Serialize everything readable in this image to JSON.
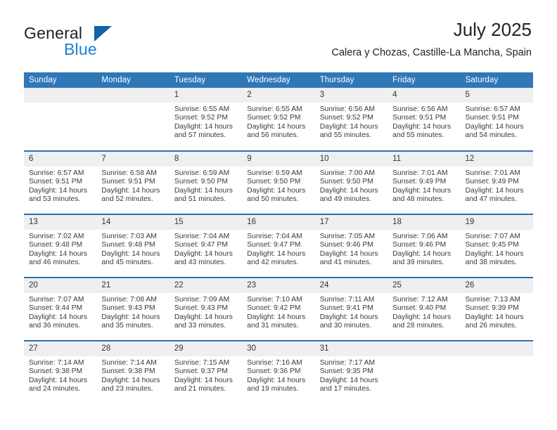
{
  "brand": {
    "word_general": "General",
    "word_blue": "Blue",
    "triangle_color": "#1162ab",
    "blue_color": "#1a7fd4"
  },
  "header": {
    "title": "July 2025",
    "subtitle": "Calera y Chozas, Castille-La Mancha, Spain"
  },
  "colors": {
    "header_blue": "#3077b8",
    "rule_blue": "#2f6fb0",
    "daynum_band": "#efeff0"
  },
  "weekday_headers": [
    "Sunday",
    "Monday",
    "Tuesday",
    "Wednesday",
    "Thursday",
    "Friday",
    "Saturday"
  ],
  "weeks": [
    [
      {
        "day": "",
        "sunrise": "",
        "sunset": "",
        "daylight1": "",
        "daylight2": ""
      },
      {
        "day": "",
        "sunrise": "",
        "sunset": "",
        "daylight1": "",
        "daylight2": ""
      },
      {
        "day": "1",
        "sunrise": "Sunrise: 6:55 AM",
        "sunset": "Sunset: 9:52 PM",
        "daylight1": "Daylight: 14 hours",
        "daylight2": "and 57 minutes."
      },
      {
        "day": "2",
        "sunrise": "Sunrise: 6:55 AM",
        "sunset": "Sunset: 9:52 PM",
        "daylight1": "Daylight: 14 hours",
        "daylight2": "and 56 minutes."
      },
      {
        "day": "3",
        "sunrise": "Sunrise: 6:56 AM",
        "sunset": "Sunset: 9:52 PM",
        "daylight1": "Daylight: 14 hours",
        "daylight2": "and 55 minutes."
      },
      {
        "day": "4",
        "sunrise": "Sunrise: 6:56 AM",
        "sunset": "Sunset: 9:51 PM",
        "daylight1": "Daylight: 14 hours",
        "daylight2": "and 55 minutes."
      },
      {
        "day": "5",
        "sunrise": "Sunrise: 6:57 AM",
        "sunset": "Sunset: 9:51 PM",
        "daylight1": "Daylight: 14 hours",
        "daylight2": "and 54 minutes."
      }
    ],
    [
      {
        "day": "6",
        "sunrise": "Sunrise: 6:57 AM",
        "sunset": "Sunset: 9:51 PM",
        "daylight1": "Daylight: 14 hours",
        "daylight2": "and 53 minutes."
      },
      {
        "day": "7",
        "sunrise": "Sunrise: 6:58 AM",
        "sunset": "Sunset: 9:51 PM",
        "daylight1": "Daylight: 14 hours",
        "daylight2": "and 52 minutes."
      },
      {
        "day": "8",
        "sunrise": "Sunrise: 6:59 AM",
        "sunset": "Sunset: 9:50 PM",
        "daylight1": "Daylight: 14 hours",
        "daylight2": "and 51 minutes."
      },
      {
        "day": "9",
        "sunrise": "Sunrise: 6:59 AM",
        "sunset": "Sunset: 9:50 PM",
        "daylight1": "Daylight: 14 hours",
        "daylight2": "and 50 minutes."
      },
      {
        "day": "10",
        "sunrise": "Sunrise: 7:00 AM",
        "sunset": "Sunset: 9:50 PM",
        "daylight1": "Daylight: 14 hours",
        "daylight2": "and 49 minutes."
      },
      {
        "day": "11",
        "sunrise": "Sunrise: 7:01 AM",
        "sunset": "Sunset: 9:49 PM",
        "daylight1": "Daylight: 14 hours",
        "daylight2": "and 48 minutes."
      },
      {
        "day": "12",
        "sunrise": "Sunrise: 7:01 AM",
        "sunset": "Sunset: 9:49 PM",
        "daylight1": "Daylight: 14 hours",
        "daylight2": "and 47 minutes."
      }
    ],
    [
      {
        "day": "13",
        "sunrise": "Sunrise: 7:02 AM",
        "sunset": "Sunset: 9:48 PM",
        "daylight1": "Daylight: 14 hours",
        "daylight2": "and 46 minutes."
      },
      {
        "day": "14",
        "sunrise": "Sunrise: 7:03 AM",
        "sunset": "Sunset: 9:48 PM",
        "daylight1": "Daylight: 14 hours",
        "daylight2": "and 45 minutes."
      },
      {
        "day": "15",
        "sunrise": "Sunrise: 7:04 AM",
        "sunset": "Sunset: 9:47 PM",
        "daylight1": "Daylight: 14 hours",
        "daylight2": "and 43 minutes."
      },
      {
        "day": "16",
        "sunrise": "Sunrise: 7:04 AM",
        "sunset": "Sunset: 9:47 PM",
        "daylight1": "Daylight: 14 hours",
        "daylight2": "and 42 minutes."
      },
      {
        "day": "17",
        "sunrise": "Sunrise: 7:05 AM",
        "sunset": "Sunset: 9:46 PM",
        "daylight1": "Daylight: 14 hours",
        "daylight2": "and 41 minutes."
      },
      {
        "day": "18",
        "sunrise": "Sunrise: 7:06 AM",
        "sunset": "Sunset: 9:46 PM",
        "daylight1": "Daylight: 14 hours",
        "daylight2": "and 39 minutes."
      },
      {
        "day": "19",
        "sunrise": "Sunrise: 7:07 AM",
        "sunset": "Sunset: 9:45 PM",
        "daylight1": "Daylight: 14 hours",
        "daylight2": "and 38 minutes."
      }
    ],
    [
      {
        "day": "20",
        "sunrise": "Sunrise: 7:07 AM",
        "sunset": "Sunset: 9:44 PM",
        "daylight1": "Daylight: 14 hours",
        "daylight2": "and 36 minutes."
      },
      {
        "day": "21",
        "sunrise": "Sunrise: 7:08 AM",
        "sunset": "Sunset: 9:43 PM",
        "daylight1": "Daylight: 14 hours",
        "daylight2": "and 35 minutes."
      },
      {
        "day": "22",
        "sunrise": "Sunrise: 7:09 AM",
        "sunset": "Sunset: 9:43 PM",
        "daylight1": "Daylight: 14 hours",
        "daylight2": "and 33 minutes."
      },
      {
        "day": "23",
        "sunrise": "Sunrise: 7:10 AM",
        "sunset": "Sunset: 9:42 PM",
        "daylight1": "Daylight: 14 hours",
        "daylight2": "and 31 minutes."
      },
      {
        "day": "24",
        "sunrise": "Sunrise: 7:11 AM",
        "sunset": "Sunset: 9:41 PM",
        "daylight1": "Daylight: 14 hours",
        "daylight2": "and 30 minutes."
      },
      {
        "day": "25",
        "sunrise": "Sunrise: 7:12 AM",
        "sunset": "Sunset: 9:40 PM",
        "daylight1": "Daylight: 14 hours",
        "daylight2": "and 28 minutes."
      },
      {
        "day": "26",
        "sunrise": "Sunrise: 7:13 AM",
        "sunset": "Sunset: 9:39 PM",
        "daylight1": "Daylight: 14 hours",
        "daylight2": "and 26 minutes."
      }
    ],
    [
      {
        "day": "27",
        "sunrise": "Sunrise: 7:14 AM",
        "sunset": "Sunset: 9:38 PM",
        "daylight1": "Daylight: 14 hours",
        "daylight2": "and 24 minutes."
      },
      {
        "day": "28",
        "sunrise": "Sunrise: 7:14 AM",
        "sunset": "Sunset: 9:38 PM",
        "daylight1": "Daylight: 14 hours",
        "daylight2": "and 23 minutes."
      },
      {
        "day": "29",
        "sunrise": "Sunrise: 7:15 AM",
        "sunset": "Sunset: 9:37 PM",
        "daylight1": "Daylight: 14 hours",
        "daylight2": "and 21 minutes."
      },
      {
        "day": "30",
        "sunrise": "Sunrise: 7:16 AM",
        "sunset": "Sunset: 9:36 PM",
        "daylight1": "Daylight: 14 hours",
        "daylight2": "and 19 minutes."
      },
      {
        "day": "31",
        "sunrise": "Sunrise: 7:17 AM",
        "sunset": "Sunset: 9:35 PM",
        "daylight1": "Daylight: 14 hours",
        "daylight2": "and 17 minutes."
      },
      {
        "day": "",
        "sunrise": "",
        "sunset": "",
        "daylight1": "",
        "daylight2": ""
      },
      {
        "day": "",
        "sunrise": "",
        "sunset": "",
        "daylight1": "",
        "daylight2": ""
      }
    ]
  ]
}
